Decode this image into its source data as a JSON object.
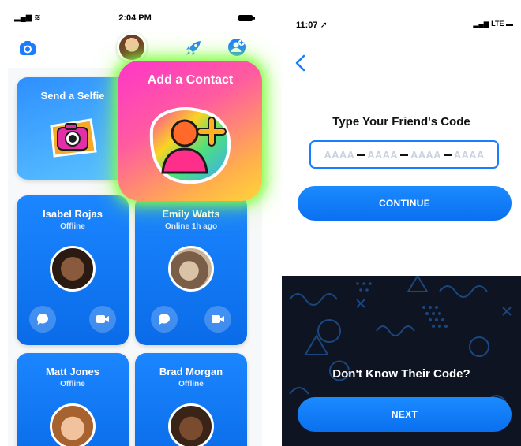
{
  "left_phone": {
    "status": {
      "time": "2:04 PM"
    },
    "selfie_tile": {
      "label": "Send a Selfie"
    },
    "add_contact": {
      "label": "Add a Contact"
    },
    "contacts": [
      {
        "name": "Isabel Rojas",
        "status": "Offline"
      },
      {
        "name": "Emily Watts",
        "status": "Online 1h ago"
      },
      {
        "name": "Matt Jones",
        "status": "Offline"
      },
      {
        "name": "Brad Morgan",
        "status": "Offline"
      }
    ]
  },
  "right_phone": {
    "status": {
      "time": "11:07",
      "network": "LTE"
    },
    "heading": "Type Your Friend's Code",
    "code_input": {
      "segments": [
        "AAAA",
        "AAAA",
        "AAAA",
        "AAAA"
      ]
    },
    "continue_label": "CONTINUE",
    "dark_heading": "Don't Know Their Code?",
    "next_label": "NEXT"
  },
  "colors": {
    "primary_blue": "#0a70ef",
    "glow_green": "#7aff3c",
    "dark_panel": "#0e1421"
  }
}
